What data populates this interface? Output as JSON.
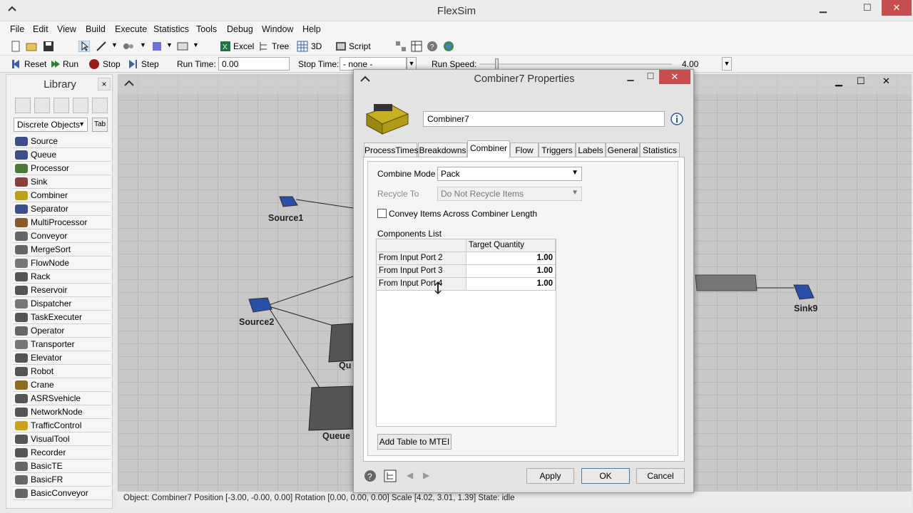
{
  "app": {
    "title": "FlexSim"
  },
  "menu": [
    "File",
    "Edit",
    "View",
    "Build",
    "Execute",
    "Statistics",
    "Tools",
    "Debug",
    "Window",
    "Help"
  ],
  "toolbar": {
    "excel": "Excel",
    "tree": "Tree",
    "three_d": "3D",
    "script": "Script"
  },
  "run_controls": {
    "reset": "Reset",
    "run": "Run",
    "stop": "Stop",
    "step": "Step",
    "run_time_label": "Run Time:",
    "run_time_value": "0.00",
    "stop_time_label": "Stop Time:",
    "stop_time_value": "- none -",
    "run_speed_label": "Run Speed:",
    "run_speed_value": "4.00"
  },
  "library": {
    "title": "Library",
    "close": "×",
    "category": "Discrete Objects",
    "tab_button": "Tab",
    "items": [
      "Source",
      "Queue",
      "Processor",
      "Sink",
      "Combiner",
      "Separator",
      "MultiProcessor",
      "Conveyor",
      "MergeSort",
      "FlowNode",
      "Rack",
      "Reservoir",
      "Dispatcher",
      "TaskExecuter",
      "Operator",
      "Transporter",
      "Elevator",
      "Robot",
      "Crane",
      "ASRSvehicle",
      "NetworkNode",
      "TrafficControl",
      "VisualTool",
      "Recorder",
      "BasicTE",
      "BasicFR",
      "BasicConveyor"
    ]
  },
  "viewport": {
    "objects": [
      "Source1",
      "Source2",
      "Qu",
      "Queue",
      "Sink9"
    ]
  },
  "status": {
    "text": "Object: Combiner7 Position [-3.00, -0.00, 0.00]  Rotation [0.00, 0.00, 0.00]  Scale [4.02, 3.01, 1.39]  State: idle"
  },
  "dialog": {
    "title": "Combiner7  Properties",
    "name": "Combiner7",
    "tabs": [
      "ProcessTimes",
      "Breakdowns",
      "Combiner",
      "Flow",
      "Triggers",
      "Labels",
      "General",
      "Statistics"
    ],
    "active_tab": "Combiner",
    "combine_mode_label": "Combine Mode",
    "combine_mode_value": "Pack",
    "recycle_label": "Recycle To",
    "recycle_value": "Do Not Recycle Items",
    "convey_label": "Convey Items Across Combiner Length",
    "components_label": "Components List",
    "column_header": "Target Quantity",
    "rows": [
      {
        "label": "From Input Port 2",
        "qty": "1.00"
      },
      {
        "label": "From Input Port 3",
        "qty": "1.00"
      },
      {
        "label": "From Input Port 4",
        "qty": "1.00"
      }
    ],
    "add_table_button": "Add Table to MTEI",
    "apply": "Apply",
    "ok": "OK",
    "cancel": "Cancel"
  },
  "colors": {
    "close_red": "#c74e4e",
    "accent_blue": "#3c7fb1"
  }
}
